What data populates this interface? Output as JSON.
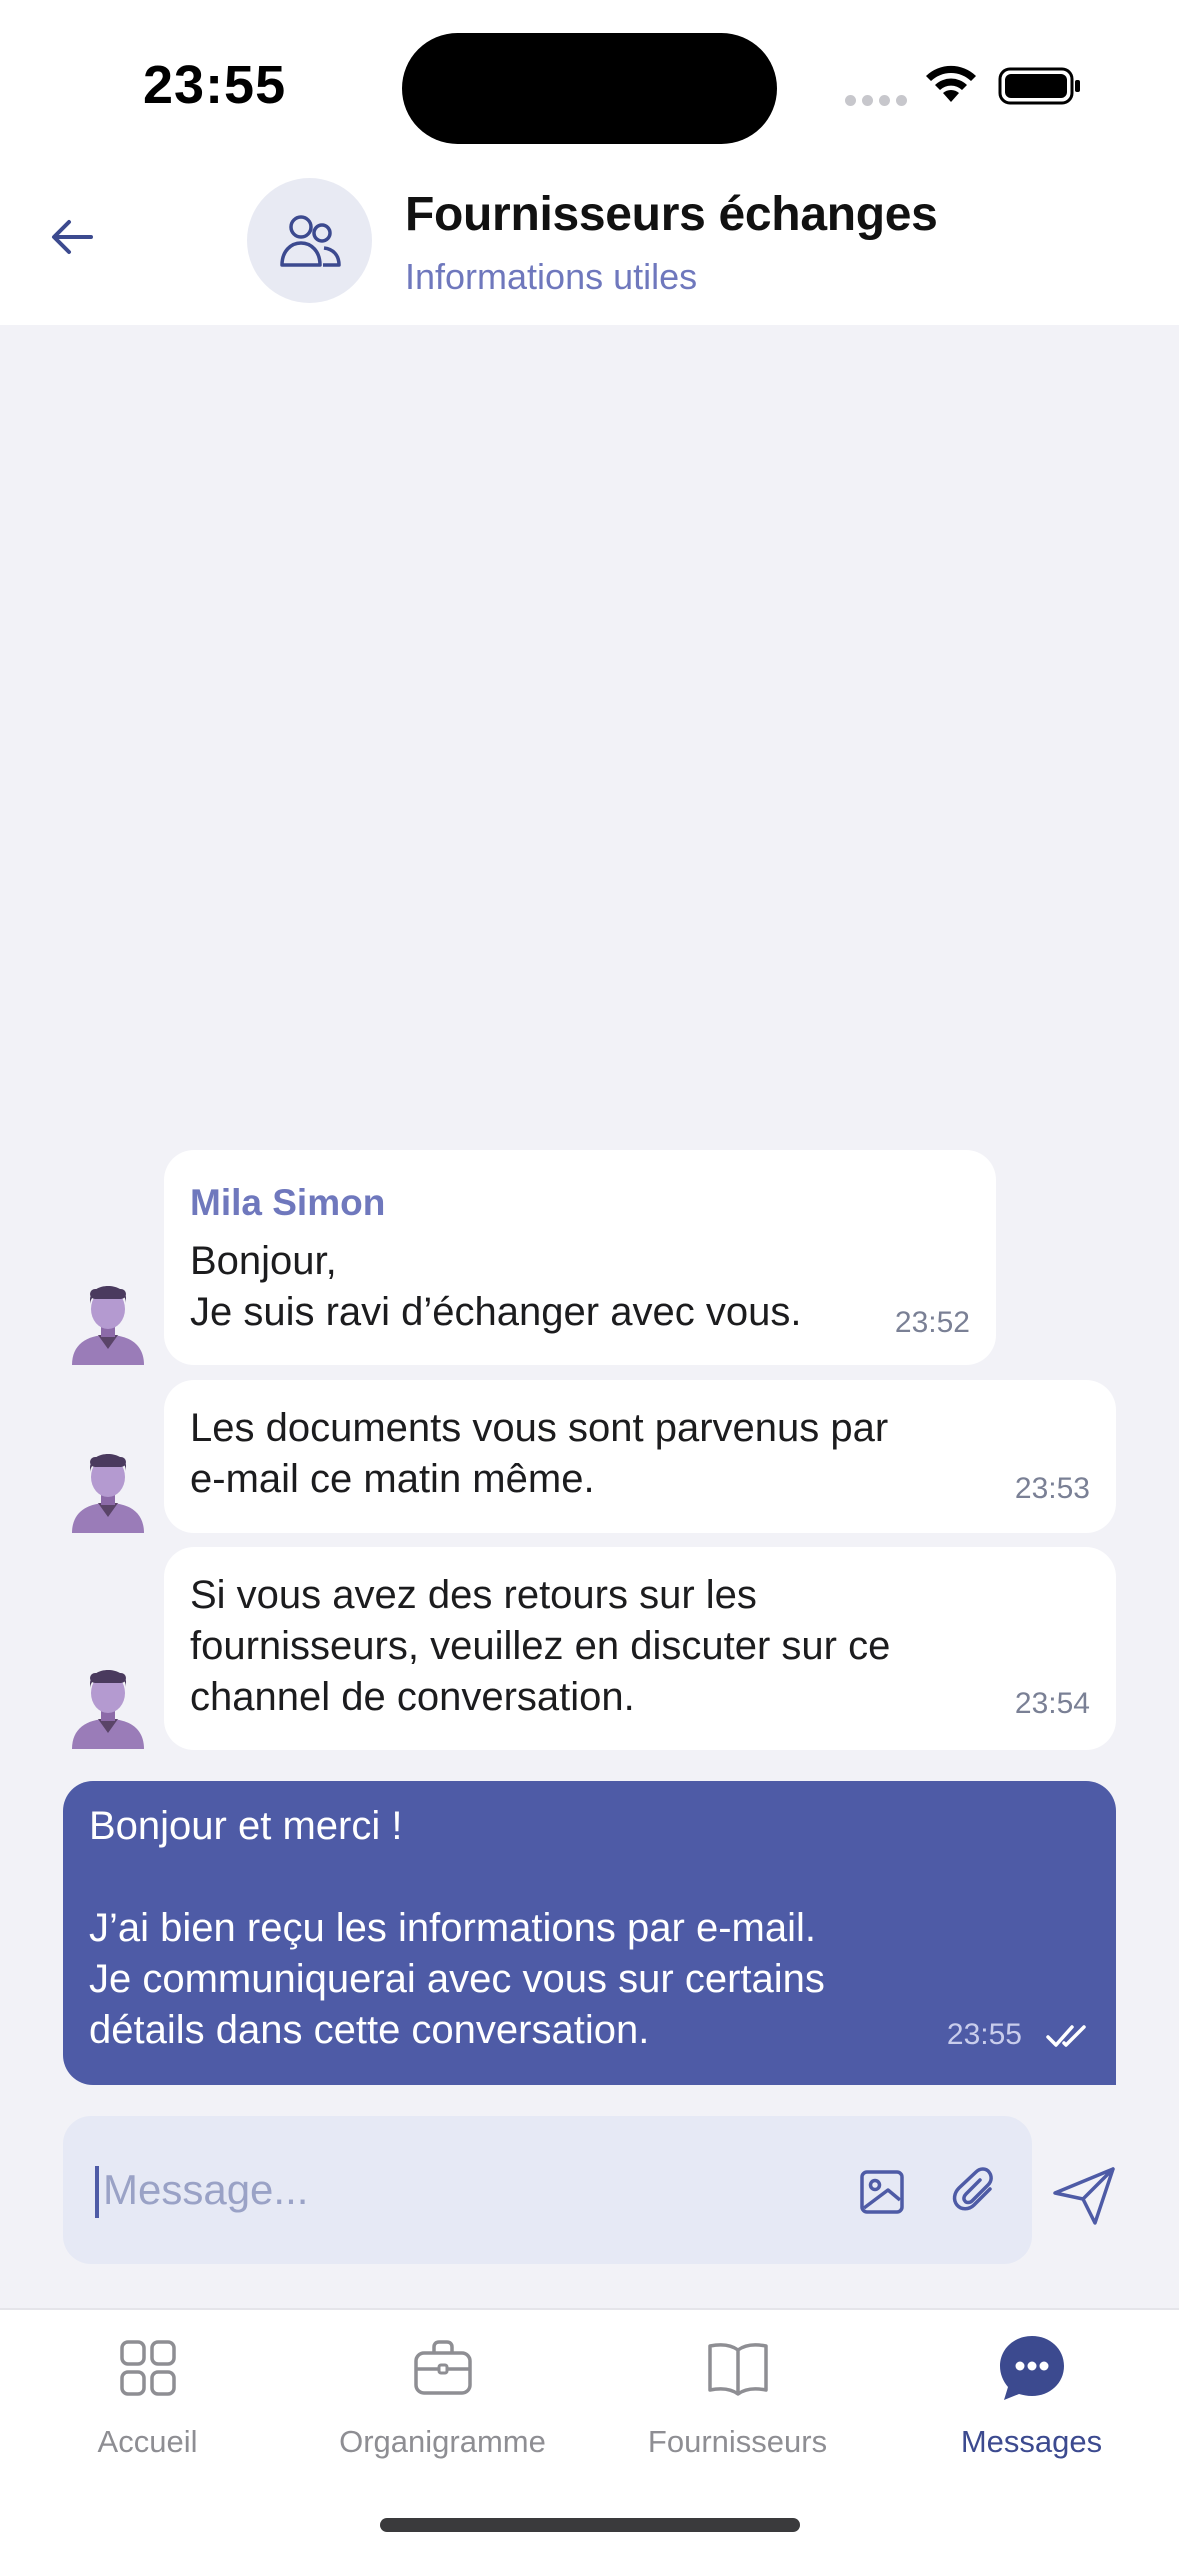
{
  "status_bar": {
    "time": "23:55"
  },
  "header": {
    "title": "Fournisseurs échanges",
    "subtitle": "Informations utiles"
  },
  "messages": [
    {
      "sender": "Mila Simon",
      "text": "Bonjour,\nJe suis ravi d’échanger avec vous.",
      "time": "23:52"
    },
    {
      "text": "Les documents vous sont parvenus par\ne-mail ce matin même.",
      "time": "23:53"
    },
    {
      "text": "Si vous avez des retours sur les\nfournisseurs, veuillez en discuter sur ce\nchannel de conversation.",
      "time": "23:54"
    },
    {
      "text": "Bonjour et merci !\n\nJ’ai bien reçu les informations par e-mail.\nJe communiquerai avec vous sur certains\ndétails dans cette conversation.",
      "time": "23:55"
    }
  ],
  "composer": {
    "placeholder": "Message..."
  },
  "tabs": [
    {
      "label": "Accueil",
      "icon": "grid-icon"
    },
    {
      "label": "Organigramme",
      "icon": "briefcase-icon"
    },
    {
      "label": "Fournisseurs",
      "icon": "book-icon"
    },
    {
      "label": "Messages",
      "icon": "chat-bubble-icon",
      "active": true
    }
  ],
  "colors": {
    "accent": "#4e5ba6",
    "subtitle": "#6f78bd",
    "background": "#f2f2f7"
  }
}
